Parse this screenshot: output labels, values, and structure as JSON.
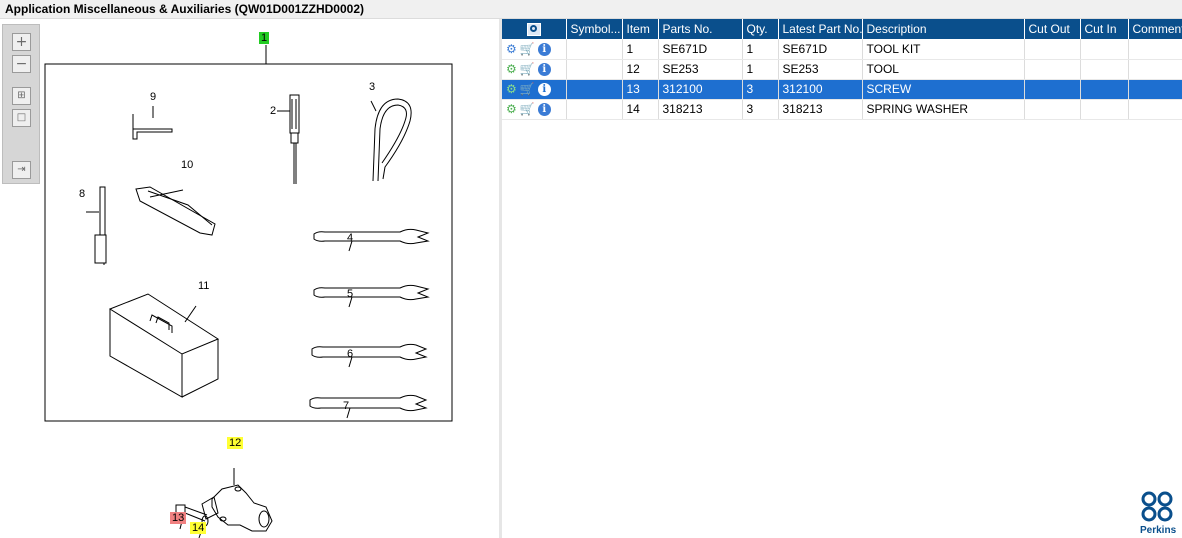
{
  "window": {
    "title": "Application Miscellaneous & Auxiliaries (QW01D001ZZHD0002)"
  },
  "zoom_toolbar": {
    "zoom_in": "+",
    "zoom_out": "−",
    "fit_all": "⊞",
    "fit_window": "□",
    "expand": "⇥"
  },
  "illustration": {
    "callouts": [
      "1",
      "2",
      "3",
      "4",
      "5",
      "6",
      "7",
      "8",
      "9",
      "10",
      "11",
      "12",
      "13",
      "14"
    ],
    "colors": {
      "highlight_green": "#22cc22",
      "highlight_yellow": "#ffff33",
      "highlight_red": "#f08080"
    }
  },
  "table": {
    "columns": [
      "",
      "Symbol...",
      "Item",
      "Parts No.",
      "Qty.",
      "Latest Part No.",
      "Description",
      "Cut Out",
      "Cut In",
      "Comment"
    ],
    "rows": [
      {
        "symbol": "",
        "item": "1",
        "part_no": "SE671D",
        "qty": "1",
        "latest": "SE671D",
        "desc": "TOOL KIT",
        "cut_out": "",
        "cut_in": "",
        "comment": ""
      },
      {
        "symbol": "",
        "item": "12",
        "part_no": "SE253",
        "qty": "1",
        "latest": "SE253",
        "desc": "TOOL",
        "cut_out": "",
        "cut_in": "",
        "comment": ""
      },
      {
        "symbol": "",
        "item": "13",
        "part_no": "312100",
        "qty": "3",
        "latest": "312100",
        "desc": "SCREW",
        "cut_out": "",
        "cut_in": "",
        "comment": ""
      },
      {
        "symbol": "",
        "item": "14",
        "part_no": "318213",
        "qty": "3",
        "latest": "318213",
        "desc": "SPRING WASHER",
        "cut_out": "",
        "cut_in": "",
        "comment": ""
      }
    ],
    "selected_row": 2,
    "colors": {
      "header": "#0a4f8c",
      "selected": "#1e6fd0"
    }
  },
  "brand": {
    "name": "Perkins"
  }
}
